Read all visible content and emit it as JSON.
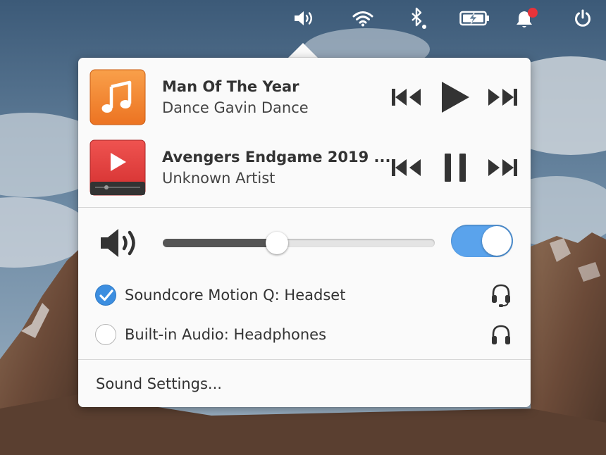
{
  "players": [
    {
      "title": "Man Of The Year",
      "artist": "Dance Gavin Dance",
      "state": "paused",
      "app_icon": "music-note-icon",
      "app_color": "#f0802e"
    },
    {
      "title": "Avengers Endgame 2019 ...",
      "artist": "Unknown Artist",
      "state": "playing",
      "app_icon": "video-play-icon",
      "app_color": "#e13b3b"
    }
  ],
  "volume": {
    "level_percent": 42,
    "muted": false,
    "switch_on": true
  },
  "devices": [
    {
      "label": "Soundcore Motion Q: Headset",
      "selected": true,
      "icon": "headset-icon"
    },
    {
      "label": "Built-in Audio: Headphones",
      "selected": false,
      "icon": "headphones-icon"
    }
  ],
  "settings_label": "Sound Settings...",
  "indicators": [
    "volume-icon",
    "wifi-icon",
    "bluetooth-icon",
    "battery-charging-icon",
    "notifications-icon",
    "power-icon"
  ],
  "colors": {
    "accent": "#5aa3ec",
    "checkbox": "#3c8ee0",
    "notification_dot": "#e8333a",
    "popover_bg": "#fafafa"
  }
}
